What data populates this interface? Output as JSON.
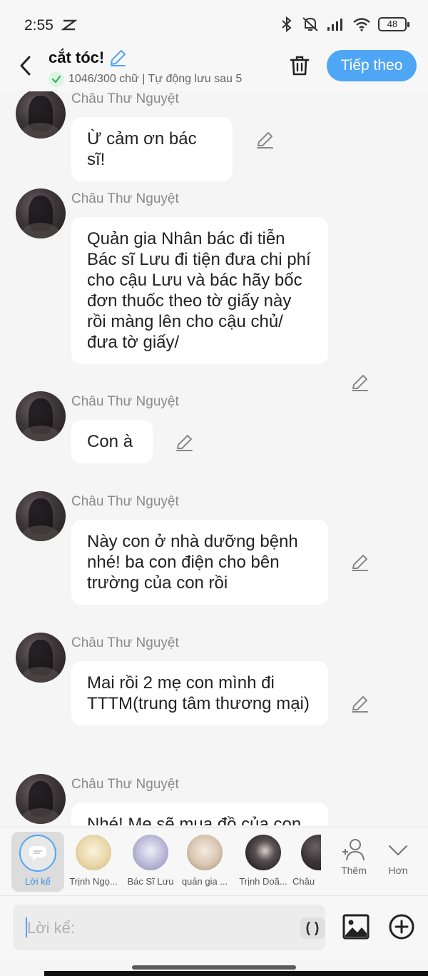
{
  "status_bar": {
    "time": "2:55",
    "battery": "48"
  },
  "header": {
    "title": "cắt tóc!",
    "subtitle": "1046/300 chữ | Tự động lưu sau 5",
    "next_label": "Tiếp theo"
  },
  "messages": [
    {
      "sender": "Châu Thư Nguyệt",
      "text": "Ừ cảm ơn bác sĩ!"
    },
    {
      "sender": "Châu Thư Nguyệt",
      "text": "Quản gia Nhân bác đi tiễn Bác sĩ Lưu đi tiện đưa chi phí cho cậu Lưu và bác hãy bốc đơn thuốc theo tờ giấy này rồi màng lên cho cậu chủ/ đưa tờ giấy/"
    },
    {
      "sender": "Châu Thư Nguyệt",
      "text": "Con à"
    },
    {
      "sender": "Châu Thư Nguyệt",
      "text": "Này con ở nhà dưỡng bệnh nhé! ba con điện cho bên trường của con rồi"
    },
    {
      "sender": "Châu Thư Nguyệt",
      "text": "Mai rồi 2 mẹ con mình đi TTTM(trung tâm thương mại)"
    },
    {
      "sender": "Châu Thư Nguyệt",
      "text": "Nhé! Mẹ sẽ mua đồ của con"
    }
  ],
  "characters": [
    {
      "label": "Lời kể"
    },
    {
      "label": "Trịnh Ngọ...",
      "color": "#e9d7a8"
    },
    {
      "label": "Bác Sĩ Lưu",
      "color": "#b9b7d6"
    },
    {
      "label": "quản gia ...",
      "color": "#d9c5b0"
    },
    {
      "label": "Trịnh Doã...",
      "color": "#2f2b2d"
    },
    {
      "label": "Châu",
      "color": "#3d3639"
    }
  ],
  "actions": {
    "add_label": "Thêm",
    "more_label": "Hơn"
  },
  "input": {
    "placeholder": "Lời kể:",
    "paren_label": "( )"
  },
  "colors": {
    "accent": "#4fa6f5",
    "bubble": "#ffffff",
    "background": "#f5f5f5"
  }
}
